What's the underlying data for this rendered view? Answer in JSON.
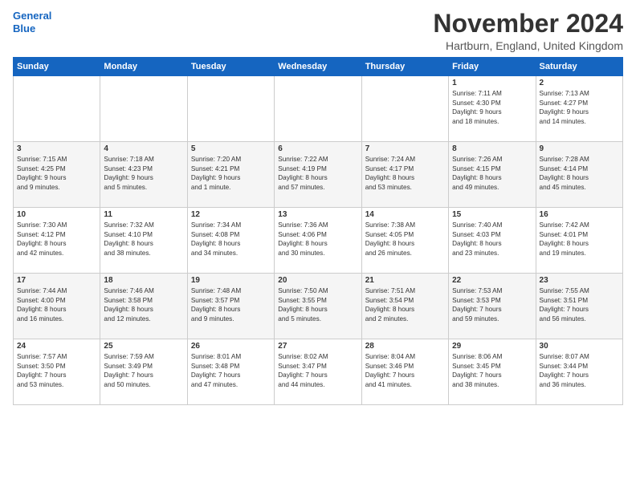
{
  "logo": {
    "line1": "General",
    "line2": "Blue"
  },
  "title": "November 2024",
  "location": "Hartburn, England, United Kingdom",
  "days_of_week": [
    "Sunday",
    "Monday",
    "Tuesday",
    "Wednesday",
    "Thursday",
    "Friday",
    "Saturday"
  ],
  "weeks": [
    [
      {
        "day": "",
        "info": ""
      },
      {
        "day": "",
        "info": ""
      },
      {
        "day": "",
        "info": ""
      },
      {
        "day": "",
        "info": ""
      },
      {
        "day": "",
        "info": ""
      },
      {
        "day": "1",
        "info": "Sunrise: 7:11 AM\nSunset: 4:30 PM\nDaylight: 9 hours\nand 18 minutes."
      },
      {
        "day": "2",
        "info": "Sunrise: 7:13 AM\nSunset: 4:27 PM\nDaylight: 9 hours\nand 14 minutes."
      }
    ],
    [
      {
        "day": "3",
        "info": "Sunrise: 7:15 AM\nSunset: 4:25 PM\nDaylight: 9 hours\nand 9 minutes."
      },
      {
        "day": "4",
        "info": "Sunrise: 7:18 AM\nSunset: 4:23 PM\nDaylight: 9 hours\nand 5 minutes."
      },
      {
        "day": "5",
        "info": "Sunrise: 7:20 AM\nSunset: 4:21 PM\nDaylight: 9 hours\nand 1 minute."
      },
      {
        "day": "6",
        "info": "Sunrise: 7:22 AM\nSunset: 4:19 PM\nDaylight: 8 hours\nand 57 minutes."
      },
      {
        "day": "7",
        "info": "Sunrise: 7:24 AM\nSunset: 4:17 PM\nDaylight: 8 hours\nand 53 minutes."
      },
      {
        "day": "8",
        "info": "Sunrise: 7:26 AM\nSunset: 4:15 PM\nDaylight: 8 hours\nand 49 minutes."
      },
      {
        "day": "9",
        "info": "Sunrise: 7:28 AM\nSunset: 4:14 PM\nDaylight: 8 hours\nand 45 minutes."
      }
    ],
    [
      {
        "day": "10",
        "info": "Sunrise: 7:30 AM\nSunset: 4:12 PM\nDaylight: 8 hours\nand 42 minutes."
      },
      {
        "day": "11",
        "info": "Sunrise: 7:32 AM\nSunset: 4:10 PM\nDaylight: 8 hours\nand 38 minutes."
      },
      {
        "day": "12",
        "info": "Sunrise: 7:34 AM\nSunset: 4:08 PM\nDaylight: 8 hours\nand 34 minutes."
      },
      {
        "day": "13",
        "info": "Sunrise: 7:36 AM\nSunset: 4:06 PM\nDaylight: 8 hours\nand 30 minutes."
      },
      {
        "day": "14",
        "info": "Sunrise: 7:38 AM\nSunset: 4:05 PM\nDaylight: 8 hours\nand 26 minutes."
      },
      {
        "day": "15",
        "info": "Sunrise: 7:40 AM\nSunset: 4:03 PM\nDaylight: 8 hours\nand 23 minutes."
      },
      {
        "day": "16",
        "info": "Sunrise: 7:42 AM\nSunset: 4:01 PM\nDaylight: 8 hours\nand 19 minutes."
      }
    ],
    [
      {
        "day": "17",
        "info": "Sunrise: 7:44 AM\nSunset: 4:00 PM\nDaylight: 8 hours\nand 16 minutes."
      },
      {
        "day": "18",
        "info": "Sunrise: 7:46 AM\nSunset: 3:58 PM\nDaylight: 8 hours\nand 12 minutes."
      },
      {
        "day": "19",
        "info": "Sunrise: 7:48 AM\nSunset: 3:57 PM\nDaylight: 8 hours\nand 9 minutes."
      },
      {
        "day": "20",
        "info": "Sunrise: 7:50 AM\nSunset: 3:55 PM\nDaylight: 8 hours\nand 5 minutes."
      },
      {
        "day": "21",
        "info": "Sunrise: 7:51 AM\nSunset: 3:54 PM\nDaylight: 8 hours\nand 2 minutes."
      },
      {
        "day": "22",
        "info": "Sunrise: 7:53 AM\nSunset: 3:53 PM\nDaylight: 7 hours\nand 59 minutes."
      },
      {
        "day": "23",
        "info": "Sunrise: 7:55 AM\nSunset: 3:51 PM\nDaylight: 7 hours\nand 56 minutes."
      }
    ],
    [
      {
        "day": "24",
        "info": "Sunrise: 7:57 AM\nSunset: 3:50 PM\nDaylight: 7 hours\nand 53 minutes."
      },
      {
        "day": "25",
        "info": "Sunrise: 7:59 AM\nSunset: 3:49 PM\nDaylight: 7 hours\nand 50 minutes."
      },
      {
        "day": "26",
        "info": "Sunrise: 8:01 AM\nSunset: 3:48 PM\nDaylight: 7 hours\nand 47 minutes."
      },
      {
        "day": "27",
        "info": "Sunrise: 8:02 AM\nSunset: 3:47 PM\nDaylight: 7 hours\nand 44 minutes."
      },
      {
        "day": "28",
        "info": "Sunrise: 8:04 AM\nSunset: 3:46 PM\nDaylight: 7 hours\nand 41 minutes."
      },
      {
        "day": "29",
        "info": "Sunrise: 8:06 AM\nSunset: 3:45 PM\nDaylight: 7 hours\nand 38 minutes."
      },
      {
        "day": "30",
        "info": "Sunrise: 8:07 AM\nSunset: 3:44 PM\nDaylight: 7 hours\nand 36 minutes."
      }
    ]
  ]
}
